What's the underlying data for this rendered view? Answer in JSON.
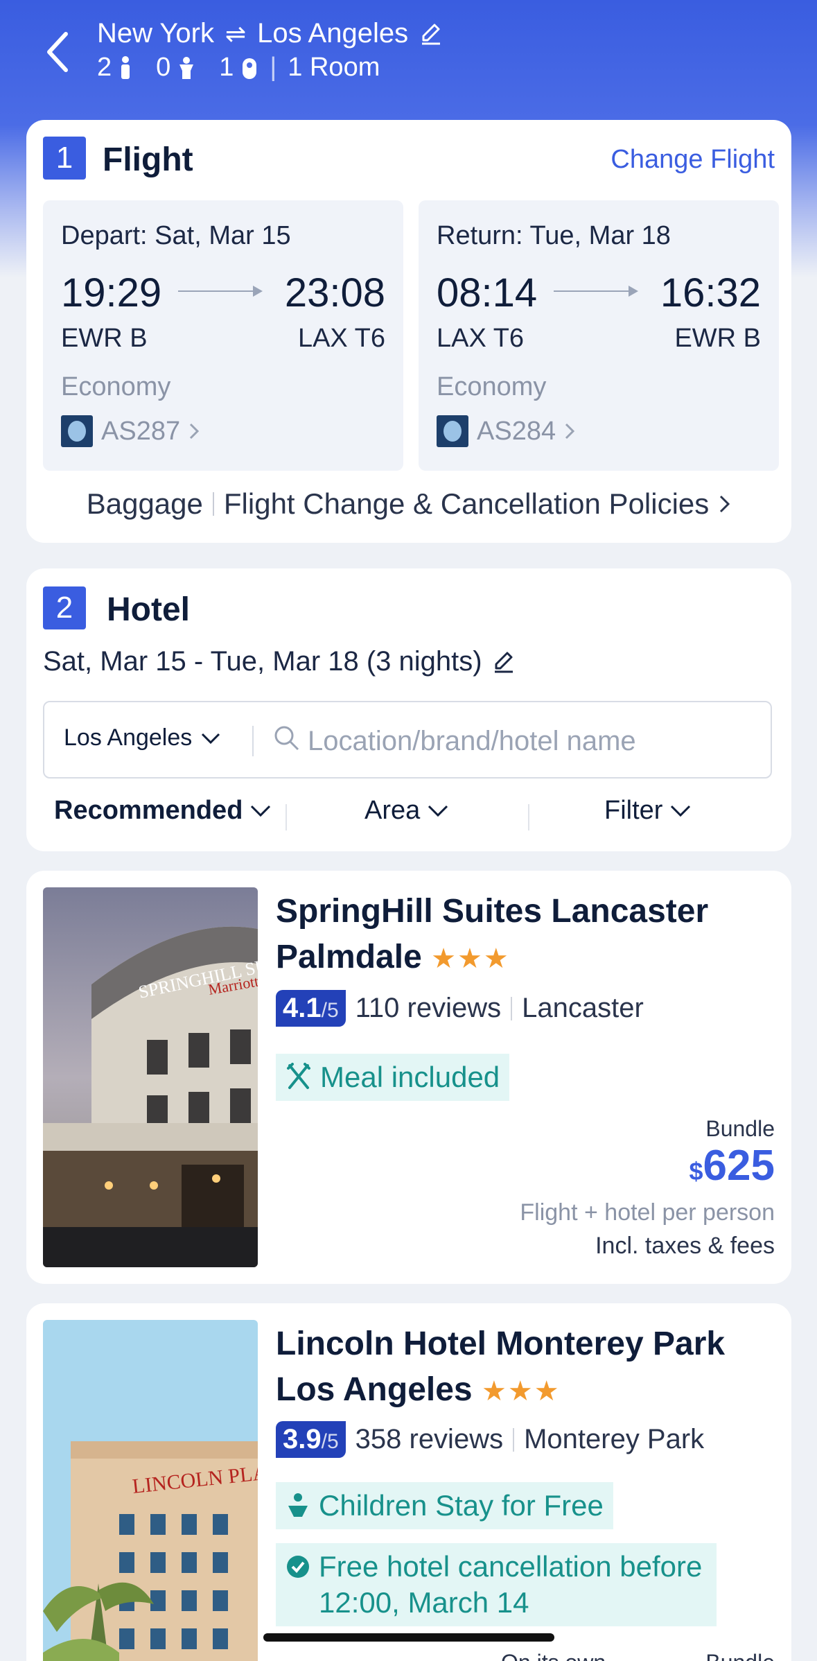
{
  "header": {
    "origin": "New York",
    "destination": "Los Angeles",
    "adults": "2",
    "children": "0",
    "infants": "1",
    "rooms": "1 Room"
  },
  "flight": {
    "section_number": "1",
    "title": "Flight",
    "change_label": "Change Flight",
    "outbound": {
      "date": "Depart: Sat, Mar 15",
      "dep_time": "19:29",
      "arr_time": "23:08",
      "dep_airport": "EWR B",
      "arr_airport": "LAX T6",
      "cabin": "Economy",
      "flight_no": "AS287"
    },
    "return": {
      "date": "Return: Tue, Mar 18",
      "dep_time": "08:14",
      "arr_time": "16:32",
      "dep_airport": "LAX T6",
      "arr_airport": "EWR B",
      "cabin": "Economy",
      "flight_no": "AS284"
    },
    "baggage_label": "Baggage",
    "policies_label": "Flight Change & Cancellation Policies"
  },
  "hotel": {
    "section_number": "2",
    "title": "Hotel",
    "dates": "Sat, Mar 15 - Tue, Mar 18 (3 nights)",
    "city": "Los Angeles",
    "search_placeholder": "Location/brand/hotel name",
    "sort_options": [
      "Recommended",
      "Area",
      "Filter"
    ]
  },
  "listings": [
    {
      "name": "SpringHill Suites Lancaster Palmdale",
      "stars": "★★★",
      "score": "4.1",
      "score_max": "/5",
      "reviews": "110 reviews",
      "location": "Lancaster",
      "tags": [
        "Meal included"
      ],
      "bundle_label": "Bundle",
      "currency": "$",
      "price": "625",
      "price_note": "Flight + hotel per person",
      "price_note2": "Incl. taxes & fees",
      "image_sign": "SPRINGHILL SUITES",
      "image_sign2": "Marriott"
    },
    {
      "name": "Lincoln Hotel Monterey Park Los Angeles",
      "stars": "★★★",
      "score": "3.9",
      "score_max": "/5",
      "reviews": "358 reviews",
      "location": "Monterey Park",
      "tags": [
        "Children Stay for Free",
        "Free hotel cancellation before 12:00, March 14"
      ],
      "image_sign": "LINCOLN PLAZA",
      "partial_left": "On its own",
      "partial_right": "Bundle"
    }
  ],
  "colors": {
    "brand": "#3a5de0",
    "score_bg": "#2341b8",
    "star": "#f29a2e",
    "tag_bg": "#e3f6f5",
    "tag_text": "#17918b"
  }
}
